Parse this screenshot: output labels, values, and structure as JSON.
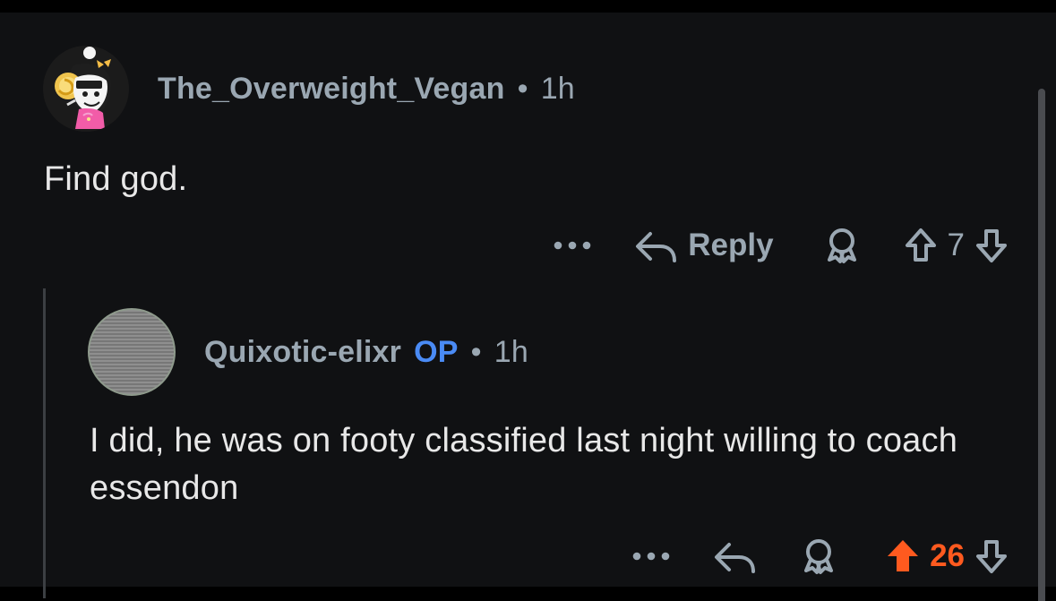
{
  "comments": [
    {
      "username": "The_Overweight_Vegan",
      "time": "1h",
      "body": "Find god.",
      "actions": {
        "more": "•••",
        "reply": "Reply",
        "votes": "7"
      }
    },
    {
      "username": "Quixotic-elixr",
      "badge": "OP",
      "time": "1h",
      "body": "I did, he was on footy classified last night willing to coach essendon",
      "actions": {
        "more": "•••",
        "votes": "26"
      }
    }
  ],
  "separator": "•",
  "colors": {
    "background": "#101113",
    "text": "#e8e8e8",
    "muted": "#9aa7b2",
    "op": "#4a8bf5",
    "upvote": "#ff5a1f"
  },
  "icons": {
    "more": "more-icon",
    "reply": "reply-icon",
    "award": "award-icon",
    "upvote": "upvote-icon",
    "downvote": "downvote-icon"
  }
}
